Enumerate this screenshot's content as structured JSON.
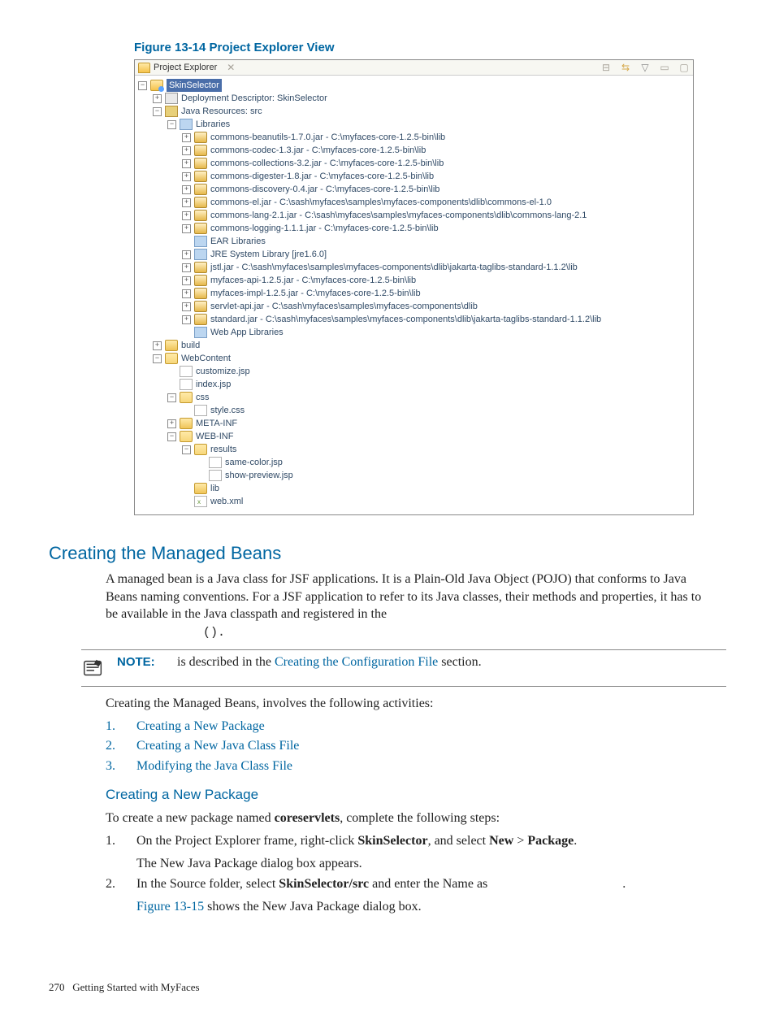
{
  "figure": {
    "caption": "Figure 13-14 Project Explorer View",
    "tab_title": "Project Explorer"
  },
  "tree": {
    "root": "SkinSelector",
    "dd": "Deployment Descriptor: SkinSelector",
    "java_res": "Java Resources: src",
    "libraries": "Libraries",
    "jars": {
      "j0": "commons-beanutils-1.7.0.jar - C:\\myfaces-core-1.2.5-bin\\lib",
      "j1": "commons-codec-1.3.jar - C:\\myfaces-core-1.2.5-bin\\lib",
      "j2": "commons-collections-3.2.jar - C:\\myfaces-core-1.2.5-bin\\lib",
      "j3": "commons-digester-1.8.jar - C:\\myfaces-core-1.2.5-bin\\lib",
      "j4": "commons-discovery-0.4.jar - C:\\myfaces-core-1.2.5-bin\\lib",
      "j5": "commons-el.jar - C:\\sash\\myfaces\\samples\\myfaces-components\\dlib\\commons-el-1.0",
      "j6": "commons-lang-2.1.jar - C:\\sash\\myfaces\\samples\\myfaces-components\\dlib\\commons-lang-2.1",
      "j7": "commons-logging-1.1.1.jar - C:\\myfaces-core-1.2.5-bin\\lib",
      "ear": "EAR Libraries",
      "jre": "JRE System Library [jre1.6.0]",
      "j8": "jstl.jar - C:\\sash\\myfaces\\samples\\myfaces-components\\dlib\\jakarta-taglibs-standard-1.1.2\\lib",
      "j9": "myfaces-api-1.2.5.jar - C:\\myfaces-core-1.2.5-bin\\lib",
      "j10": "myfaces-impl-1.2.5.jar - C:\\myfaces-core-1.2.5-bin\\lib",
      "j11": "servlet-api.jar - C:\\sash\\myfaces\\samples\\myfaces-components\\dlib",
      "j12": "standard.jar - C:\\sash\\myfaces\\samples\\myfaces-components\\dlib\\jakarta-taglibs-standard-1.1.2\\lib",
      "webapp": "Web App Libraries"
    },
    "build": "build",
    "webcontent": "WebContent",
    "customize": "customize.jsp",
    "index": "index.jsp",
    "css": "css",
    "style": "style.css",
    "metainf": "META-INF",
    "webinf": "WEB-INF",
    "results": "results",
    "samecolor": "same-color.jsp",
    "showpreview": "show-preview.jsp",
    "lib": "lib",
    "webxml": "web.xml"
  },
  "section": {
    "title": "Creating the Managed Beans",
    "para": "A managed bean is a Java class for JSF applications. It is a Plain-Old Java Object (POJO) that conforms to Java Beans naming conventions. For a JSF application to refer to its Java classes, their methods and properties, it has to be available in the Java classpath and registered in the",
    "mono_suffix": "().",
    "note_label": "NOTE:",
    "note_text_1": "is described in the ",
    "note_link": "Creating the Configuration File",
    "note_text_2": " section.",
    "activities_intro": "Creating the Managed Beans, involves the following activities:",
    "acts": {
      "a1": "Creating a New Package",
      "a2": "Creating a New Java Class File",
      "a3": "Modifying the Java Class File"
    },
    "subtitle": "Creating a New Package",
    "sub_intro_1": "To create a new package named ",
    "sub_intro_bold": "coreservlets",
    "sub_intro_2": ", complete the following steps:",
    "steps": {
      "s1a": "On the Project Explorer frame, right-click ",
      "s1b": "SkinSelector",
      "s1c": ", and select ",
      "s1d": "New",
      "s1e": " > ",
      "s1f": "Package",
      "s1g": ".",
      "s1_after": "The New Java Package dialog box appears.",
      "s2a": "In the Source folder, select ",
      "s2b": "SkinSelector/src",
      "s2c": " and enter the Name as ",
      "s2d": ".",
      "s2_after1": "Figure 13-15",
      "s2_after2": " shows the New Java Package dialog box."
    }
  },
  "footer": {
    "page": "270",
    "text": "Getting Started with MyFaces"
  }
}
